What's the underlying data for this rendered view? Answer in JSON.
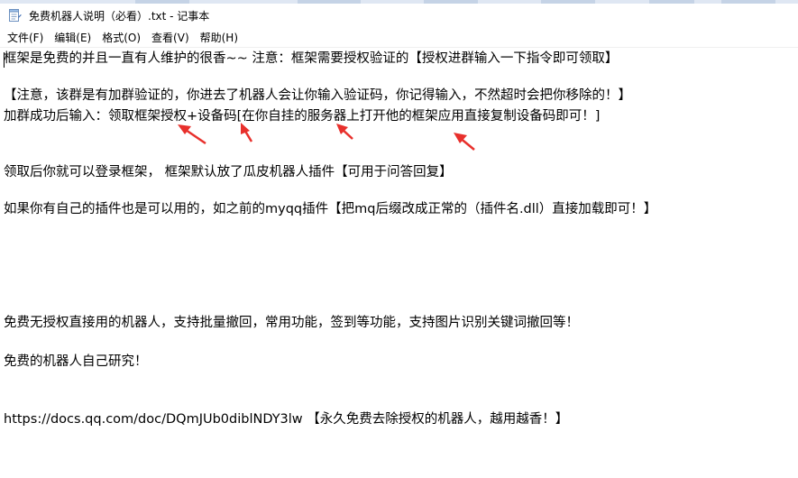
{
  "window": {
    "title": "免费机器人说明（必看）.txt - 记事本",
    "app_icon": "notepad-icon"
  },
  "menu": [
    "文件(F)",
    "编辑(E)",
    "格式(O)",
    "查看(V)",
    "帮助(H)"
  ],
  "document": {
    "lines": [
      "框架是免费的并且一直有人维护的很香~~    注意：框架需要授权验证的【授权进群输入一下指令即可领取】",
      "【注意，该群是有加群验证的，你进去了机器人会让你输入验证码，你记得输入，不然超时会把你移除的！】",
      "加群成功后输入：领取框架授权+设备码[在你自挂的服务器上打开他的框架应用直接复制设备码即可！]",
      "领取后你就可以登录框架，  框架默认放了瓜皮机器人插件【可用于问答回复】",
      "如果你有自己的插件也是可以用的，如之前的myqq插件【把mq后缀改成正常的（插件名.dll）直接加载即可！】",
      "免费无授权直接用的机器人，支持批量撤回，常用功能，签到等功能，支持图片识别关键词撤回等！",
      "免费的机器人自己研究！",
      "https://docs.qq.com/doc/DQmJUb0diblNDY3lw     【永久免费去除授权的机器人，越用越香！】"
    ]
  },
  "annotation_color": "#e8302c"
}
